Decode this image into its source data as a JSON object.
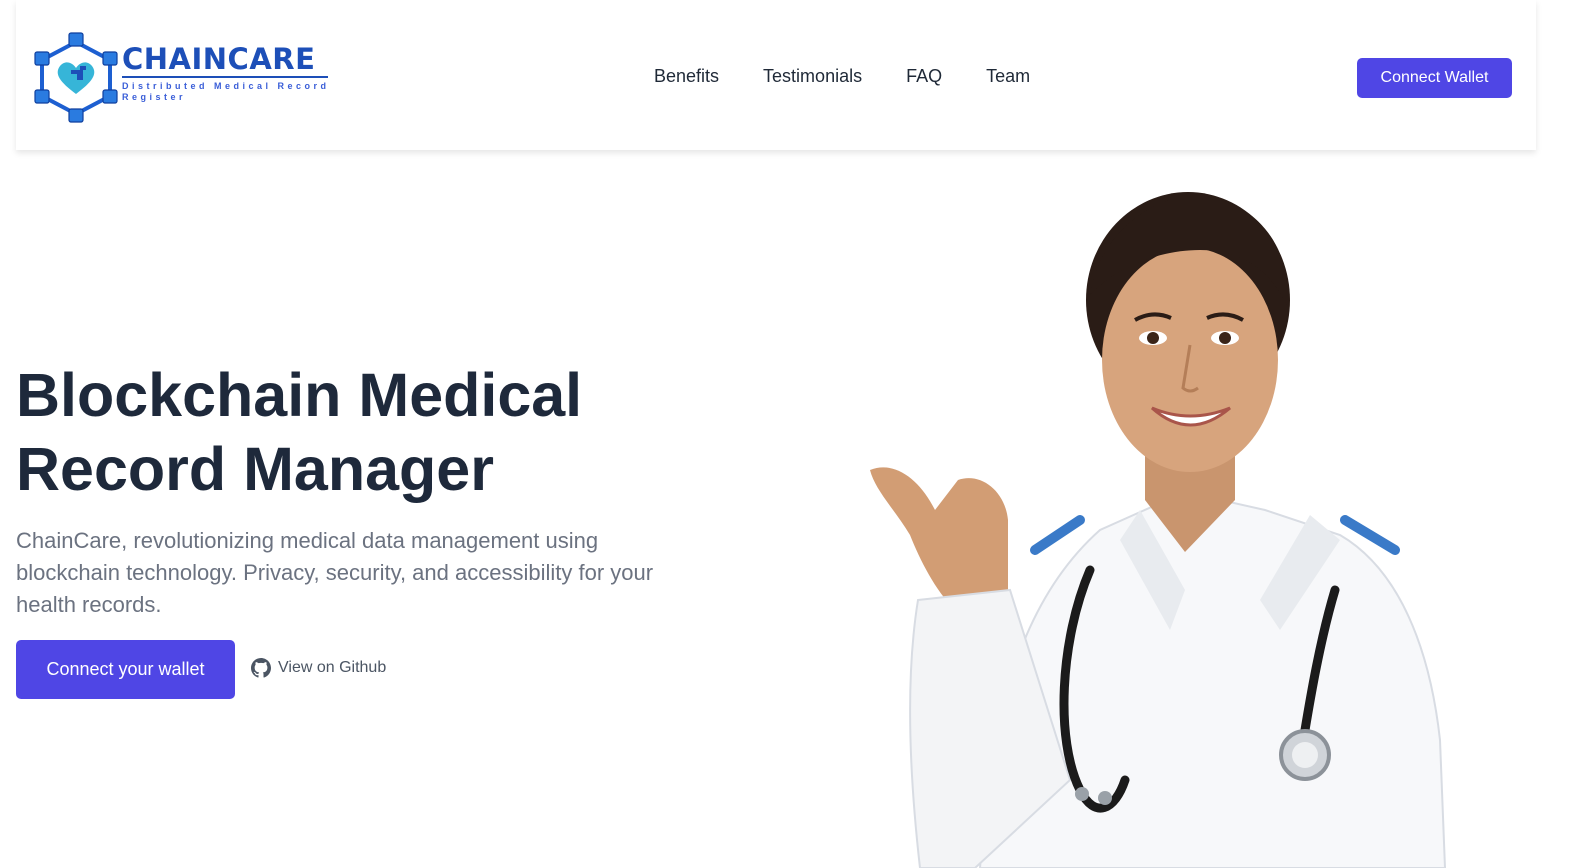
{
  "header": {
    "logo": {
      "title": "CHAINCARE",
      "subtitle": "Distributed Medical Record Register"
    },
    "nav": [
      {
        "label": "Benefits"
      },
      {
        "label": "Testimonials"
      },
      {
        "label": "FAQ"
      },
      {
        "label": "Team"
      }
    ],
    "connect_label": "Connect Wallet"
  },
  "hero": {
    "title": "Blockchain Medical Record Manager",
    "subtitle": "ChainCare, revolutionizing medical data management using blockchain technology. Privacy, security, and accessibility for your health records.",
    "primary_cta": "Connect your wallet",
    "github_label": "View on Github",
    "image_icon": "doctor-illustration"
  },
  "colors": {
    "accent": "#4f46e5",
    "brand": "#1d4fb8",
    "heading": "#1e293b",
    "muted": "#6b7280"
  }
}
